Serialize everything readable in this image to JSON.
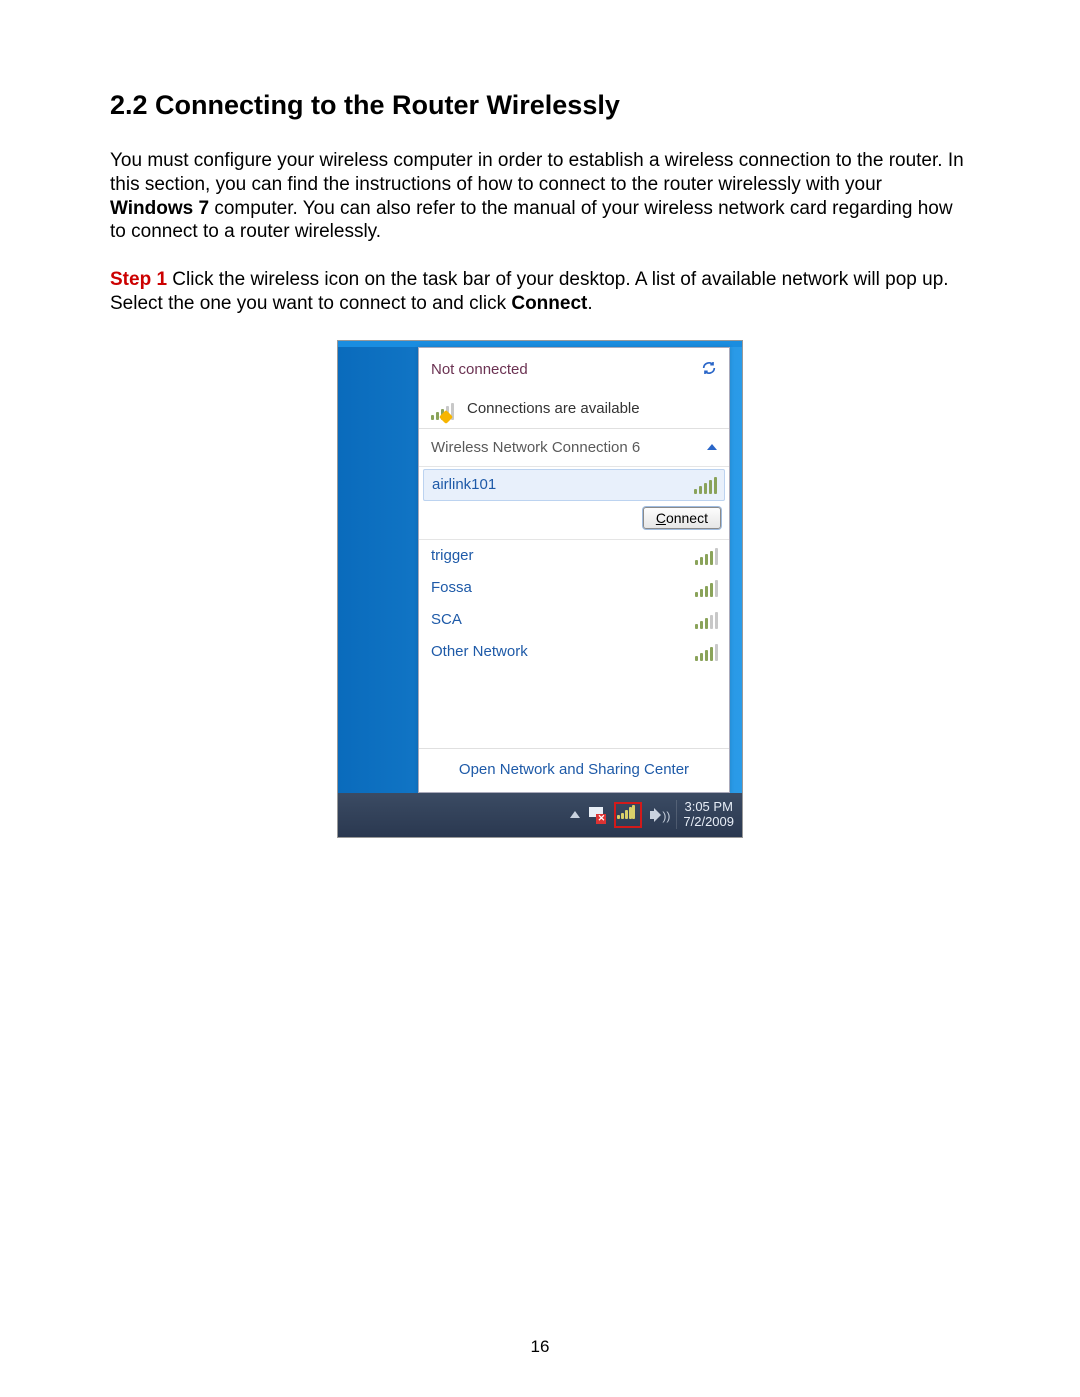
{
  "heading": "2.2 Connecting to the Router Wirelessly",
  "para1_a": "You must configure your wireless computer in order to establish a wireless connection to the router. In this section, you can find the instructions of how to connect to the router wirelessly with your ",
  "para1_bold": "Windows 7",
  "para1_b": " computer. You can also refer to the manual of your wireless network card regarding how to connect to a router wirelessly.",
  "step_label": "Step 1",
  "step_text_a": " Click the wireless icon on the task bar of your desktop. A list of available network will pop up. Select the one you want to connect to and click ",
  "step_bold": "Connect",
  "step_text_b": ".",
  "flyout": {
    "status": "Not connected",
    "available": "Connections are available",
    "adapter": "Wireless Network Connection 6",
    "connect_u": "C",
    "connect_rest": "onnect",
    "networks": [
      {
        "name": "airlink101",
        "strength": 5,
        "selected": true
      },
      {
        "name": "trigger",
        "strength": 4,
        "selected": false
      },
      {
        "name": "Fossa",
        "strength": 4,
        "selected": false
      },
      {
        "name": "SCA",
        "strength": 3,
        "selected": false
      },
      {
        "name": "Other Network",
        "strength": 4,
        "selected": false
      }
    ],
    "footer": "Open Network and Sharing Center"
  },
  "taskbar": {
    "time": "3:05 PM",
    "date": "7/2/2009"
  },
  "page_number": "16"
}
